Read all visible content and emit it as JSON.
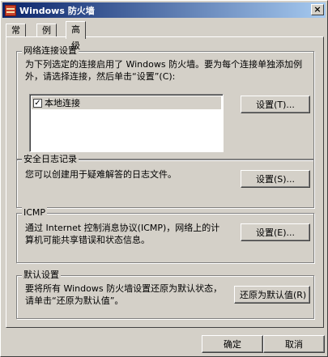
{
  "window": {
    "title": "Windows 防火墙",
    "close_glyph": "×"
  },
  "tabs": [
    {
      "label": "常规",
      "active": false
    },
    {
      "label": "例外",
      "active": false
    },
    {
      "label": "高级",
      "active": true
    }
  ],
  "network": {
    "legend": "网络连接设置",
    "description": "为下列选定的连接启用了 Windows 防火墙。要为每个连接单独添加例\n外，请选择连接，然后单击“设置”(C):",
    "connections": [
      {
        "label": "本地连接",
        "checked": true
      }
    ],
    "settings_button": "设置(T)..."
  },
  "security_log": {
    "legend": "安全日志记录",
    "description": "您可以创建用于疑难解答的日志文件。",
    "settings_button": "设置(S)..."
  },
  "icmp": {
    "legend": "ICMP",
    "description": "通过 Internet 控制消息协议(ICMP)，网络上的计\n算机可能共享错误和状态信息。",
    "settings_button": "设置(E)..."
  },
  "defaults": {
    "legend": "默认设置",
    "description": "要将所有 Windows 防火墙设置还原为默认状态，\n请单击“还原为默认值”。",
    "restore_button": "还原为默认值(R)"
  },
  "footer": {
    "ok": "确定",
    "cancel": "取消"
  }
}
